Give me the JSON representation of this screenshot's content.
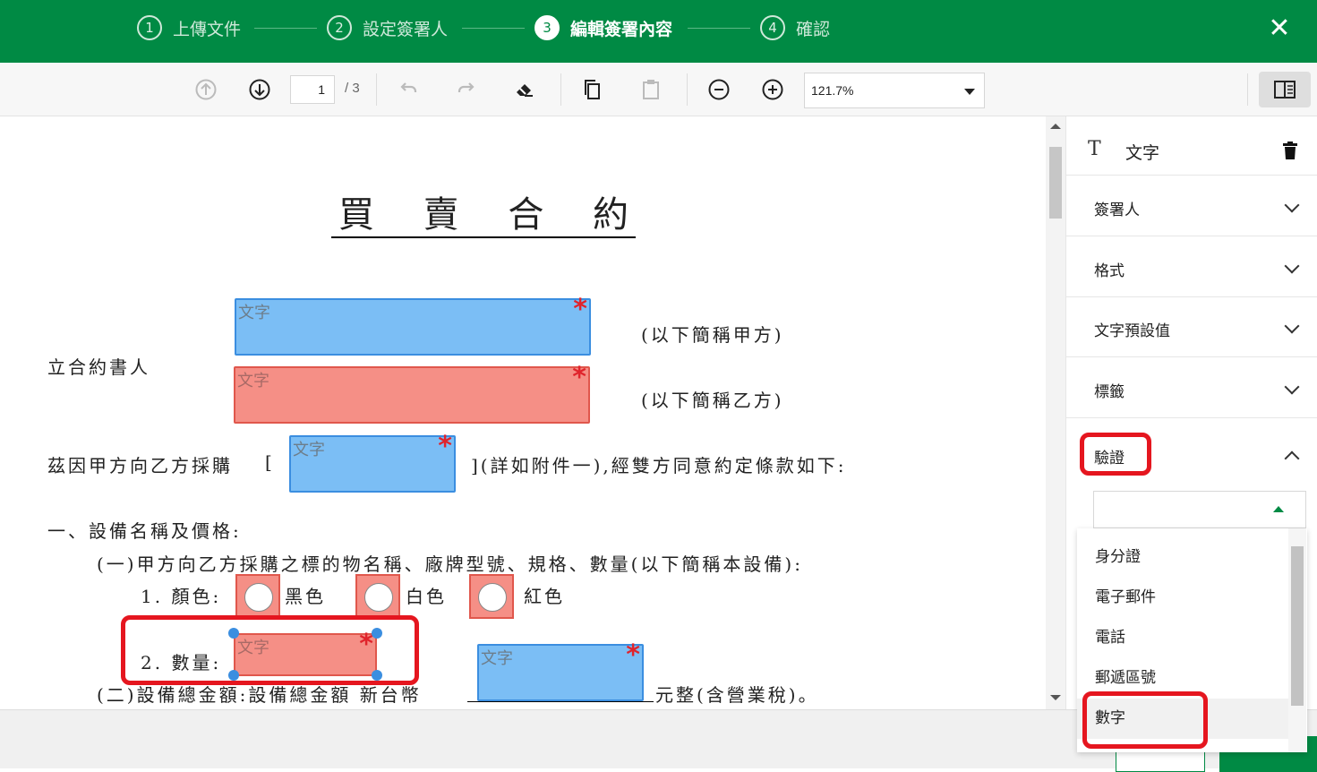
{
  "header": {
    "steps": [
      {
        "num": "1",
        "label": "上傳文件"
      },
      {
        "num": "2",
        "label": "設定簽署人"
      },
      {
        "num": "3",
        "label": "編輯簽署內容"
      },
      {
        "num": "4",
        "label": "確認"
      }
    ],
    "close": "✕"
  },
  "toolbar": {
    "page_current": "1",
    "page_total": "/ 3",
    "zoom": "121.7%"
  },
  "document": {
    "title_chars": [
      "買",
      "賣",
      "合",
      "約"
    ],
    "party_label": "立合約書人",
    "party_a_suffix": "(以下簡稱甲方)",
    "party_b_suffix": "(以下簡稱乙方)",
    "purchase_prefix": "茲因甲方向乙方採購",
    "bracket_open": "[",
    "purchase_suffix": "](詳如附件一),經雙方同意約定條款如下:",
    "section1": "一、設備名稱及價格:",
    "sub1": "(一)甲方向乙方採購之標的物名稱、廠牌型號、規格、數量(以下簡稱本設備):",
    "item1_label": "1. 顏色:",
    "color_black": "黑色",
    "color_white": "白色",
    "color_red": "紅色",
    "item2_label": "2. 數量:",
    "sub2": "(二)設備總金額:設備總金額 新台幣",
    "sub2_suffix": "元整(含營業稅)。",
    "field_placeholder": "文字",
    "required_mark": "*"
  },
  "panel": {
    "field_type": "文字",
    "sections": [
      "簽署人",
      "格式",
      "文字預設值",
      "標籤",
      "驗證"
    ],
    "validation_options": [
      "身分證",
      "電子郵件",
      "電話",
      "郵遞區號",
      "數字"
    ],
    "selected_option": "數字"
  },
  "colors": {
    "header_green": "#008a44",
    "field_blue": "#7bbef5",
    "field_red": "#f58f86",
    "highlight_red": "#e5161f"
  }
}
